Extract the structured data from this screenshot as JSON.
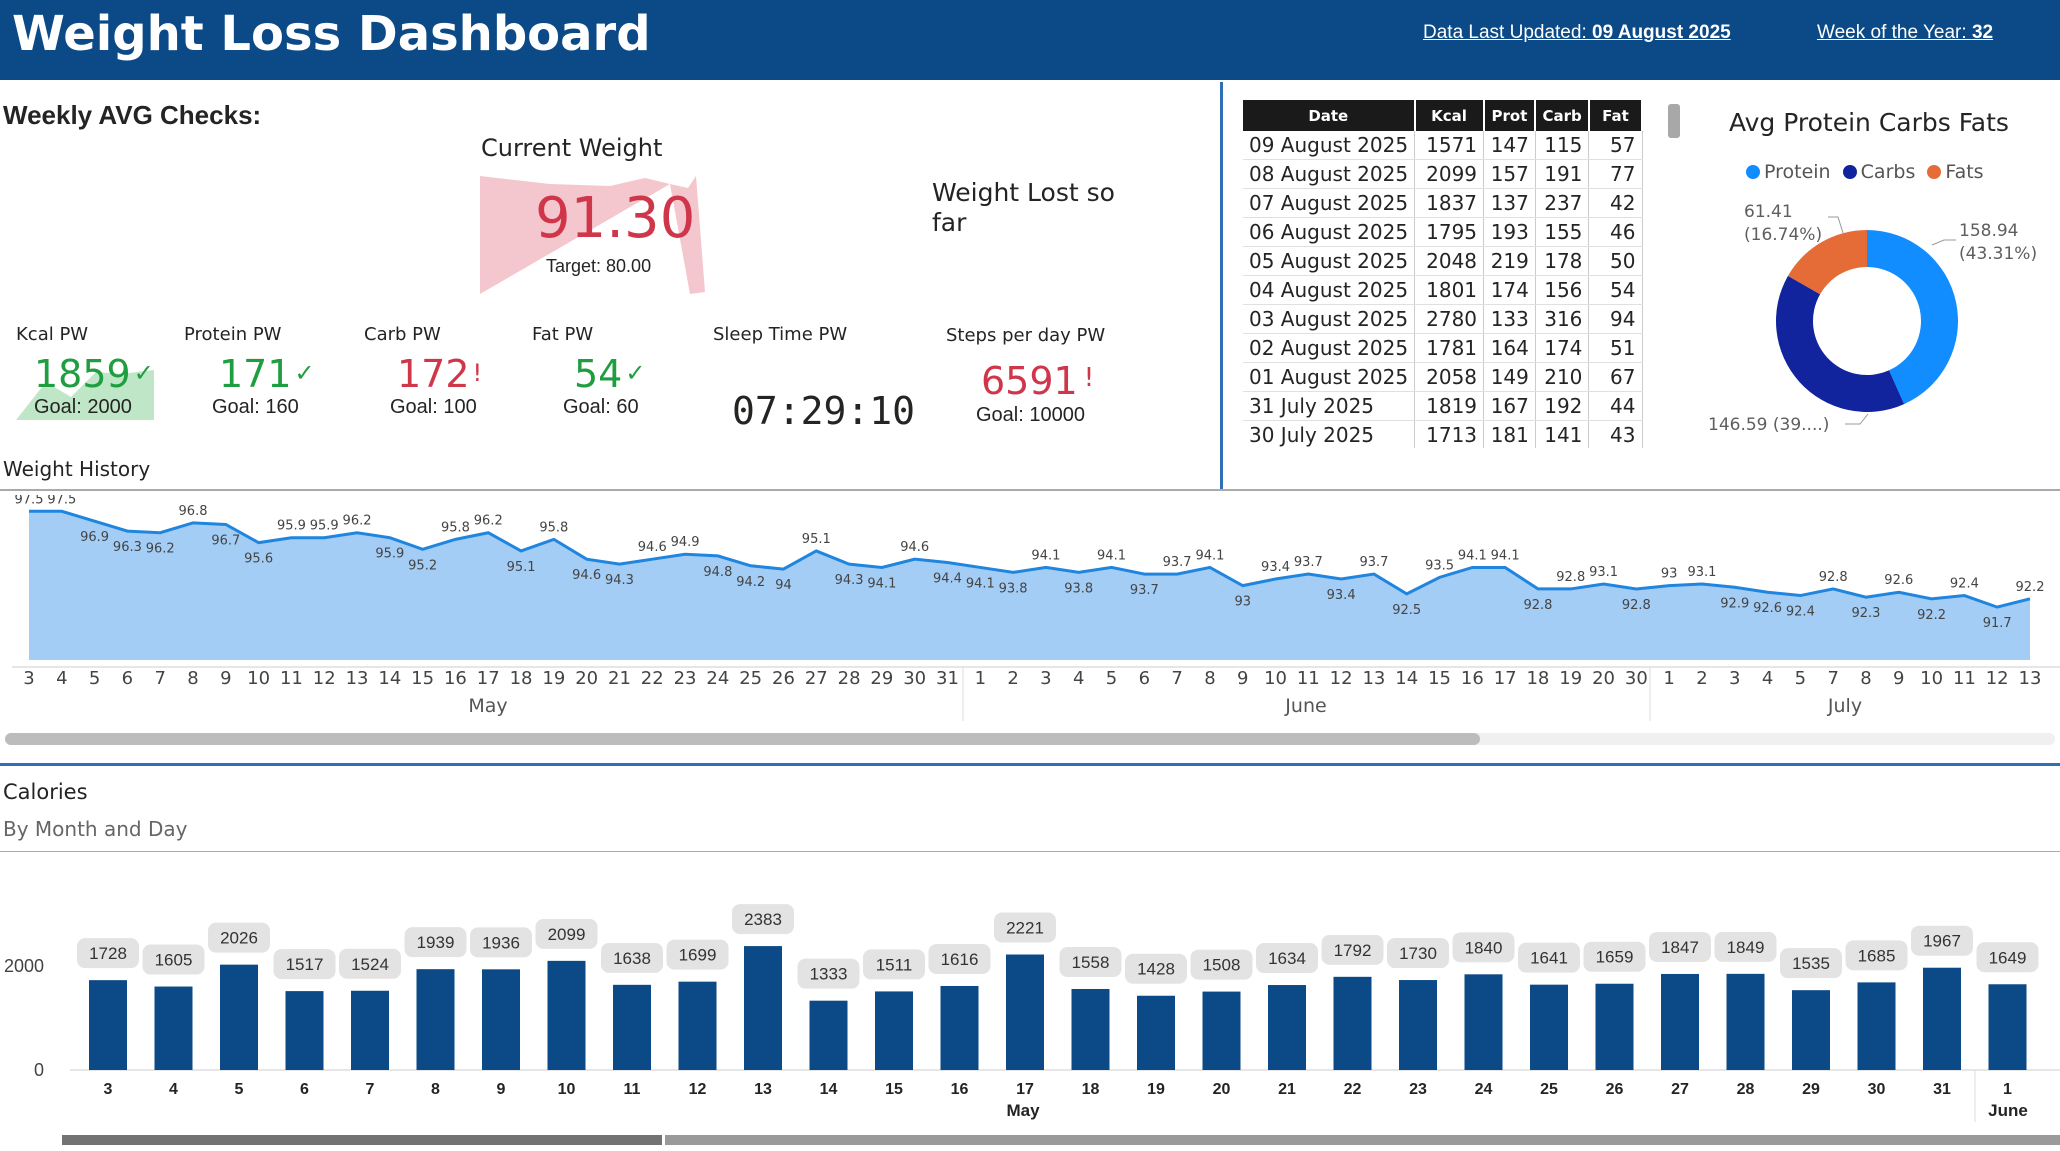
{
  "header": {
    "title": "Weight Loss Dashboard",
    "updated_label": "Data Last Updated",
    "updated_value": "09 August 2025",
    "week_label": "Week of the Year",
    "week_value": "32",
    "colors": {
      "bar": "#0b4a86"
    }
  },
  "weekly": {
    "title": "Weekly AVG Checks:",
    "current_weight_label": "Current Weight",
    "current_weight_value": "91.30",
    "current_weight_target": "Target: 80.00",
    "weight_lost_label_line1": "Weight Lost so",
    "weight_lost_label_line2": "far",
    "kpis": [
      {
        "label": "Kcal PW",
        "value": "1859",
        "status": "✓",
        "goal": "Goal: 2000",
        "ok": true
      },
      {
        "label": "Protein PW",
        "value": "171",
        "status": "✓",
        "goal": "Goal: 160",
        "ok": true
      },
      {
        "label": "Carb PW",
        "value": "172",
        "status": "!",
        "goal": "Goal: 100",
        "ok": false
      },
      {
        "label": "Fat PW",
        "value": "54",
        "status": "✓",
        "goal": "Goal: 60",
        "ok": true
      }
    ],
    "sleep_label": "Sleep Time PW",
    "sleep_value": "07:29:10",
    "steps_label": "Steps per day PW",
    "steps_value": "6591",
    "steps_status": "!",
    "steps_goal": "Goal: 10000"
  },
  "table": {
    "columns": [
      "Date",
      "Kcal",
      "Prot",
      "Carb",
      "Fat"
    ],
    "rows": [
      [
        "09 August 2025",
        "1571",
        "147",
        "115",
        "57"
      ],
      [
        "08 August 2025",
        "2099",
        "157",
        "191",
        "77"
      ],
      [
        "07 August 2025",
        "1837",
        "137",
        "237",
        "42"
      ],
      [
        "06 August 2025",
        "1795",
        "193",
        "155",
        "46"
      ],
      [
        "05 August 2025",
        "2048",
        "219",
        "178",
        "50"
      ],
      [
        "04 August 2025",
        "1801",
        "174",
        "156",
        "54"
      ],
      [
        "03 August 2025",
        "2780",
        "133",
        "316",
        "94"
      ],
      [
        "02 August 2025",
        "1781",
        "164",
        "174",
        "51"
      ],
      [
        "01 August 2025",
        "2058",
        "149",
        "210",
        "67"
      ],
      [
        "31 July 2025",
        "1819",
        "167",
        "192",
        "44"
      ],
      [
        "30 July 2025",
        "1713",
        "181",
        "141",
        "43"
      ]
    ]
  },
  "donut": {
    "title": "Avg Protein Carbs Fats",
    "labels": [
      "61.41",
      "(16.74%)",
      "158.94",
      "(43.31%)",
      "146.59 (39....)"
    ],
    "chart_data": {
      "type": "pie",
      "categories": [
        "Protein",
        "Carbs",
        "Fats"
      ],
      "values": [
        158.94,
        146.59,
        61.41
      ],
      "colors": [
        "#118dff",
        "#12239e",
        "#e66c37"
      ]
    }
  },
  "weight_history": {
    "title": "Weight History",
    "months": [
      "May",
      "June",
      "July"
    ],
    "chart_data": {
      "type": "area",
      "x": [
        "3",
        "4",
        "5",
        "6",
        "7",
        "8",
        "9",
        "10",
        "11",
        "12",
        "13",
        "14",
        "15",
        "16",
        "17",
        "18",
        "19",
        "20",
        "21",
        "22",
        "23",
        "24",
        "25",
        "26",
        "27",
        "28",
        "29",
        "30",
        "31",
        "1",
        "2",
        "3",
        "4",
        "5",
        "6",
        "7",
        "8",
        "9",
        "10",
        "11",
        "12",
        "13",
        "14",
        "15",
        "16",
        "17",
        "18",
        "19",
        "20",
        "30",
        "1",
        "2",
        "3",
        "4",
        "5",
        "7",
        "8",
        "9",
        "10",
        "11",
        "12",
        "13"
      ],
      "values": [
        97.5,
        97.5,
        96.9,
        96.3,
        96.2,
        96.8,
        96.7,
        95.6,
        95.9,
        95.9,
        96.2,
        95.9,
        95.2,
        95.8,
        96.2,
        95.1,
        95.8,
        94.6,
        94.3,
        94.6,
        94.9,
        94.8,
        94.2,
        94.0,
        95.1,
        94.3,
        94.1,
        94.6,
        94.4,
        94.1,
        93.8,
        94.1,
        93.8,
        94.1,
        93.7,
        93.7,
        94.1,
        93.0,
        93.4,
        93.7,
        93.4,
        93.7,
        92.5,
        93.5,
        94.1,
        94.1,
        92.8,
        92.8,
        93.1,
        92.8,
        93.0,
        93.1,
        92.9,
        92.6,
        92.4,
        92.8,
        92.3,
        92.6,
        92.2,
        92.4,
        91.7,
        92.2
      ],
      "ylim": [
        88.5,
        98
      ]
    }
  },
  "calories": {
    "title": "Calories",
    "subtitle": "By Month and Day",
    "month_labels": [
      "May",
      "June"
    ],
    "chart_data": {
      "type": "bar",
      "categories": [
        "3",
        "4",
        "5",
        "6",
        "7",
        "8",
        "9",
        "10",
        "11",
        "12",
        "13",
        "14",
        "15",
        "16",
        "17",
        "18",
        "19",
        "20",
        "21",
        "22",
        "23",
        "24",
        "25",
        "26",
        "27",
        "28",
        "29",
        "30",
        "31",
        "1"
      ],
      "values": [
        1728,
        1605,
        2026,
        1517,
        1524,
        1939,
        1936,
        2099,
        1638,
        1699,
        2383,
        1333,
        1511,
        1616,
        2221,
        1558,
        1428,
        1508,
        1634,
        1792,
        1730,
        1840,
        1641,
        1659,
        1847,
        1849,
        1535,
        1685,
        1967,
        1649
      ],
      "y_ticks": [
        "0",
        "2000"
      ],
      "ylim": [
        0,
        2500
      ]
    }
  }
}
